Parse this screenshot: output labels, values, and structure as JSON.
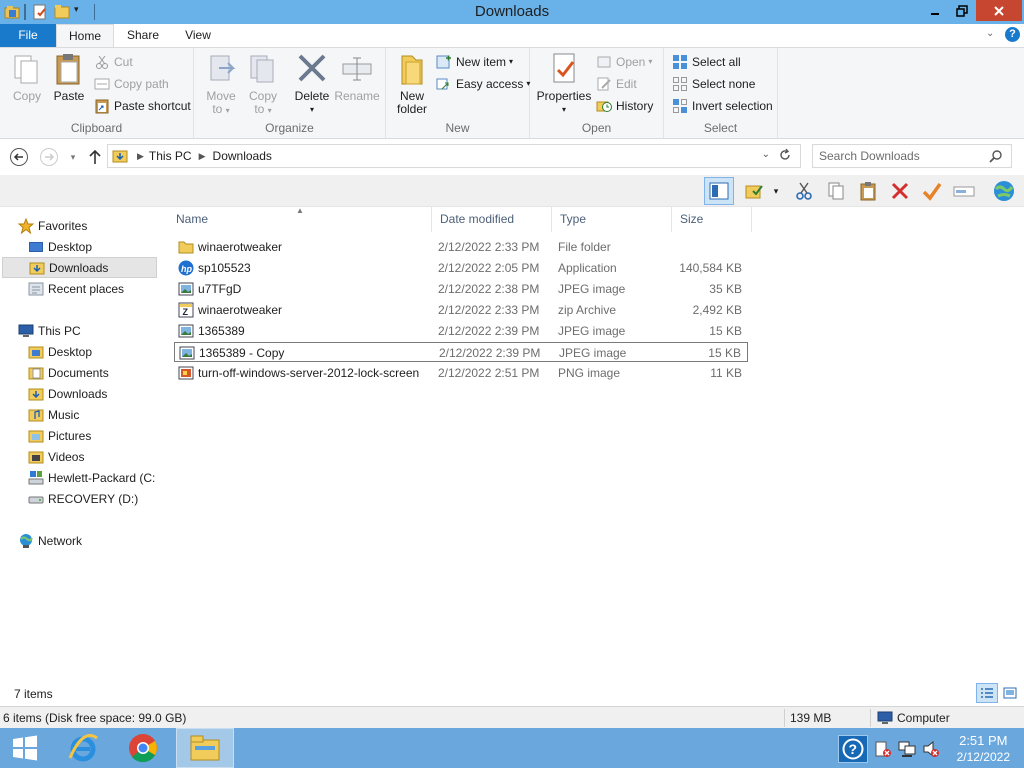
{
  "window": {
    "title": "Downloads"
  },
  "tabs": {
    "file": "File",
    "home": "Home",
    "share": "Share",
    "view": "View"
  },
  "ribbon": {
    "clipboard": {
      "label": "Clipboard",
      "copy": "Copy",
      "paste": "Paste",
      "cut": "Cut",
      "copy_path": "Copy path",
      "paste_shortcut": "Paste shortcut"
    },
    "organize": {
      "label": "Organize",
      "move_to_1": "Move",
      "move_to_2": "to",
      "copy_to_1": "Copy",
      "copy_to_2": "to",
      "delete": "Delete",
      "rename": "Rename"
    },
    "new": {
      "label": "New",
      "new_folder_1": "New",
      "new_folder_2": "folder",
      "new_item": "New item",
      "easy_access": "Easy access"
    },
    "open": {
      "label": "Open",
      "properties": "Properties",
      "open": "Open",
      "edit": "Edit",
      "history": "History"
    },
    "select": {
      "label": "Select",
      "select_all": "Select all",
      "select_none": "Select none",
      "invert_selection": "Invert selection"
    }
  },
  "address": {
    "crumbs": [
      "This PC",
      "Downloads"
    ],
    "search_placeholder": "Search Downloads"
  },
  "navpane": {
    "favorites": "Favorites",
    "fav_items": [
      "Desktop",
      "Downloads",
      "Recent places"
    ],
    "this_pc": "This PC",
    "pc_items": [
      "Desktop",
      "Documents",
      "Downloads",
      "Music",
      "Pictures",
      "Videos",
      "Hewlett-Packard (C:",
      "RECOVERY (D:)"
    ],
    "network": "Network"
  },
  "columns": {
    "name": "Name",
    "date": "Date modified",
    "type": "Type",
    "size": "Size"
  },
  "files": [
    {
      "name": "winaerotweaker",
      "date": "2/12/2022 2:33 PM",
      "type": "File folder",
      "size": "",
      "icon": "folder-icon"
    },
    {
      "name": "sp105523",
      "date": "2/12/2022 2:05 PM",
      "type": "Application",
      "size": "140,584 KB",
      "icon": "hp-app-icon"
    },
    {
      "name": "u7TFgD",
      "date": "2/12/2022 2:38 PM",
      "type": "JPEG image",
      "size": "35 KB",
      "icon": "image-icon"
    },
    {
      "name": "winaerotweaker",
      "date": "2/12/2022 2:33 PM",
      "type": "zip Archive",
      "size": "2,492 KB",
      "icon": "zip-icon"
    },
    {
      "name": "1365389",
      "date": "2/12/2022 2:39 PM",
      "type": "JPEG image",
      "size": "15 KB",
      "icon": "image-icon"
    },
    {
      "name": "1365389 - Copy",
      "date": "2/12/2022 2:39 PM",
      "type": "JPEG image",
      "size": "15 KB",
      "icon": "image-icon"
    },
    {
      "name": "turn-off-windows-server-2012-lock-screen",
      "date": "2/12/2022 2:51 PM",
      "type": "PNG image",
      "size": "11 KB",
      "icon": "png-icon"
    }
  ],
  "status": {
    "item_count": "7 items",
    "summary": "6 items (Disk free space: 99.0 GB)",
    "size": "139 MB",
    "location": "Computer"
  },
  "taskbar": {
    "time": "2:51 PM",
    "date": "2/12/2022"
  }
}
